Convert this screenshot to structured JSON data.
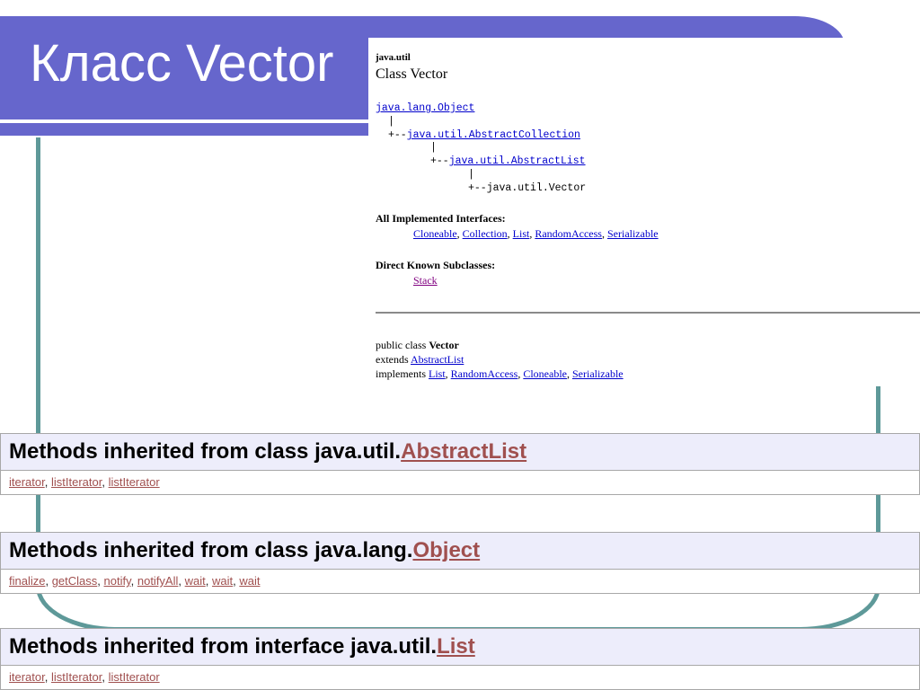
{
  "slide": {
    "title": "Класс Vector"
  },
  "doc": {
    "package": "java.util",
    "class_heading": "Class Vector",
    "hierarchy": {
      "root": "java.lang.Object",
      "pipe": "|",
      "branch": "+--",
      "level1": "java.util.AbstractCollection",
      "level2": "java.util.AbstractList",
      "level3": "java.util.Vector"
    },
    "interfaces_label": "All Implemented Interfaces:",
    "interfaces": [
      "Cloneable",
      "Collection",
      "List",
      "RandomAccess",
      "Serializable"
    ],
    "subclasses_label": "Direct Known Subclasses:",
    "subclass": "Stack",
    "declaration": {
      "prefix": "public class ",
      "name": "Vector",
      "extends_kw": "extends ",
      "extends": "AbstractList",
      "implements_kw": "implements ",
      "implements": [
        "List",
        "RandomAccess",
        "Cloneable",
        "Serializable"
      ]
    },
    "separator": ", "
  },
  "tables": [
    {
      "prefix": "Methods inherited from class java.util.",
      "link": "AbstractList",
      "methods": [
        "iterator",
        "listIterator",
        "listIterator"
      ]
    },
    {
      "prefix": "Methods inherited from class java.lang.",
      "link": "Object",
      "methods": [
        "finalize",
        "getClass",
        "notify",
        "notifyAll",
        "wait",
        "wait",
        "wait"
      ]
    },
    {
      "prefix": "Methods inherited from interface java.util.",
      "link": "List",
      "methods": [
        "iterator",
        "listIterator",
        "listIterator"
      ]
    }
  ]
}
